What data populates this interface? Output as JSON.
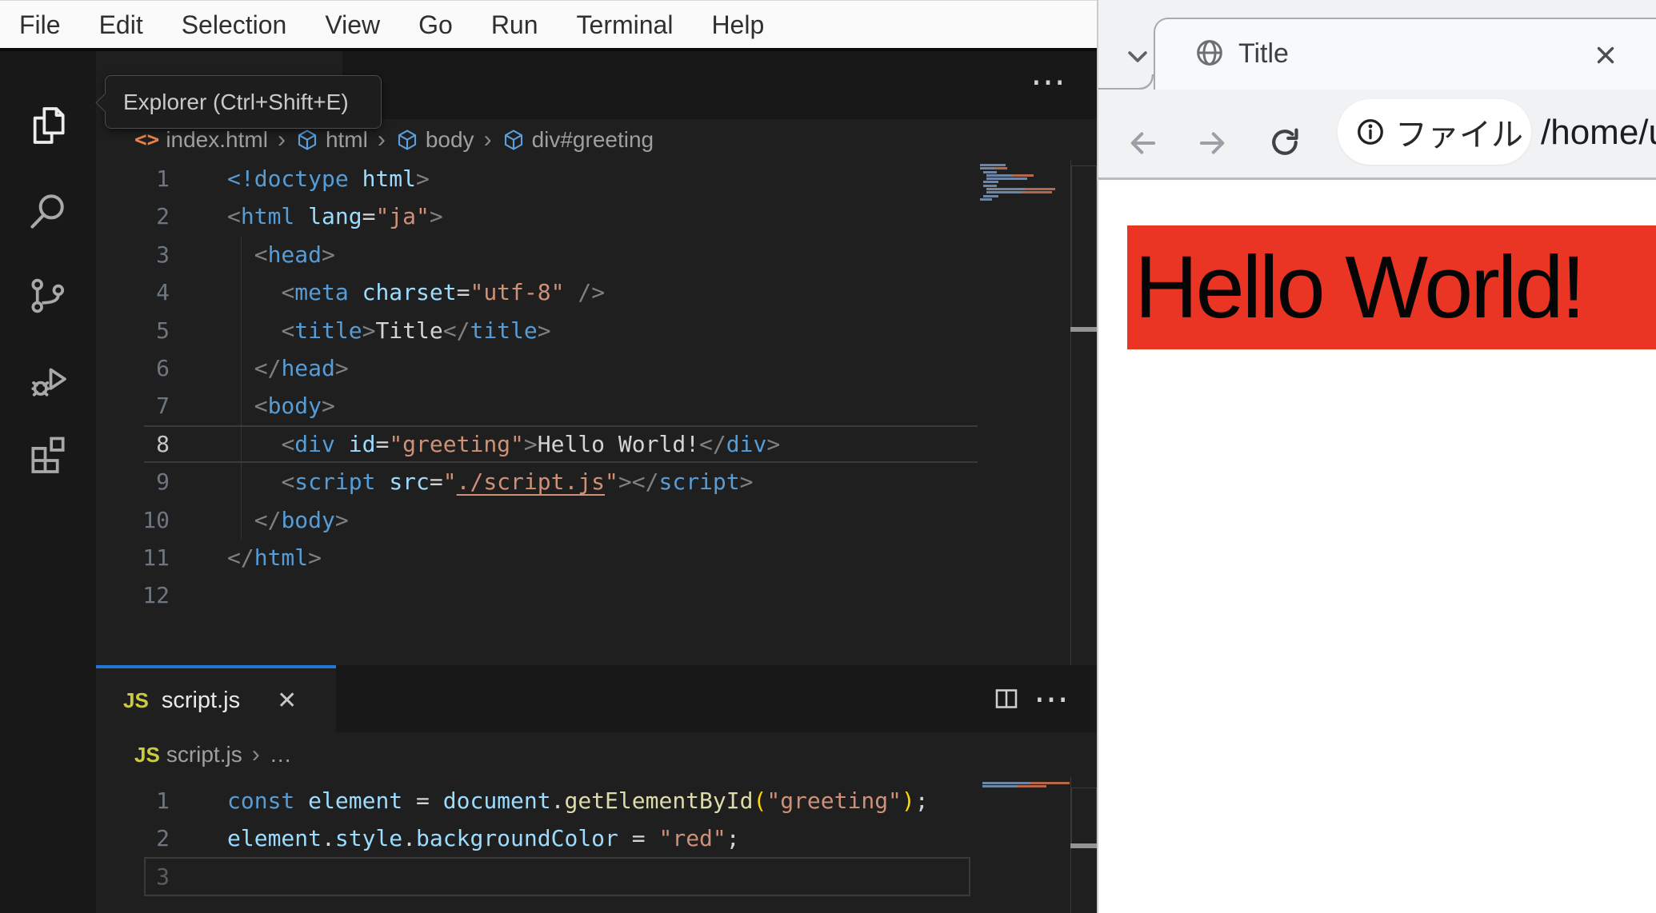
{
  "menubar": {
    "items": [
      "File",
      "Edit",
      "Selection",
      "View",
      "Go",
      "Run",
      "Terminal",
      "Help"
    ]
  },
  "activity_bar": {
    "tooltip": "Explorer (Ctrl+Shift+E)",
    "icons": [
      {
        "name": "explorer",
        "active": true
      },
      {
        "name": "search",
        "active": false
      },
      {
        "name": "source-control",
        "active": false
      },
      {
        "name": "run-and-debug",
        "active": false
      },
      {
        "name": "extensions",
        "active": false
      }
    ]
  },
  "editor_top": {
    "more_actions_glyph": "⋯",
    "breadcrumb": {
      "file_icon_glyph": "<>",
      "file": "index.html",
      "separator": "›",
      "path": [
        "html",
        "body",
        "div#greeting"
      ]
    },
    "active_line": 8,
    "lines": [
      {
        "n": 1,
        "ind": 0,
        "tok": [
          [
            "tg",
            "<!doctype"
          ],
          [
            "pl",
            " "
          ],
          [
            "at",
            "html"
          ],
          [
            "pu",
            ">"
          ]
        ]
      },
      {
        "n": 2,
        "ind": 0,
        "tok": [
          [
            "pu",
            "<"
          ],
          [
            "tg",
            "html"
          ],
          [
            "pl",
            " "
          ],
          [
            "at",
            "lang"
          ],
          [
            "pl",
            "="
          ],
          [
            "st",
            "\"ja\""
          ],
          [
            "pu",
            ">"
          ]
        ]
      },
      {
        "n": 3,
        "ind": 2,
        "tok": [
          [
            "pu",
            "<"
          ],
          [
            "tg",
            "head"
          ],
          [
            "pu",
            ">"
          ]
        ]
      },
      {
        "n": 4,
        "ind": 4,
        "tok": [
          [
            "pu",
            "<"
          ],
          [
            "tg",
            "meta"
          ],
          [
            "pl",
            " "
          ],
          [
            "at",
            "charset"
          ],
          [
            "pl",
            "="
          ],
          [
            "st",
            "\"utf-8\""
          ],
          [
            "pl",
            " "
          ],
          [
            "pu",
            "/>"
          ]
        ]
      },
      {
        "n": 5,
        "ind": 4,
        "tok": [
          [
            "pu",
            "<"
          ],
          [
            "tg",
            "title"
          ],
          [
            "pu",
            ">"
          ],
          [
            "pl",
            "Title"
          ],
          [
            "pu",
            "</"
          ],
          [
            "tg",
            "title"
          ],
          [
            "pu",
            ">"
          ]
        ]
      },
      {
        "n": 6,
        "ind": 2,
        "tok": [
          [
            "pu",
            "</"
          ],
          [
            "tg",
            "head"
          ],
          [
            "pu",
            ">"
          ]
        ]
      },
      {
        "n": 7,
        "ind": 2,
        "tok": [
          [
            "pu",
            "<"
          ],
          [
            "tg",
            "body"
          ],
          [
            "pu",
            ">"
          ]
        ]
      },
      {
        "n": 8,
        "ind": 4,
        "tok": [
          [
            "pu",
            "<"
          ],
          [
            "tg",
            "div"
          ],
          [
            "pl",
            " "
          ],
          [
            "at",
            "id"
          ],
          [
            "pl",
            "="
          ],
          [
            "st",
            "\"greeting\""
          ],
          [
            "pu",
            ">"
          ],
          [
            "pl",
            "Hello World!"
          ],
          [
            "pu",
            "</"
          ],
          [
            "tg",
            "div"
          ],
          [
            "pu",
            ">"
          ]
        ]
      },
      {
        "n": 9,
        "ind": 4,
        "tok": [
          [
            "pu",
            "<"
          ],
          [
            "tg",
            "script"
          ],
          [
            "pl",
            " "
          ],
          [
            "at",
            "src"
          ],
          [
            "pl",
            "="
          ],
          [
            "st",
            "\""
          ],
          [
            "lk",
            "./script.js"
          ],
          [
            "st",
            "\""
          ],
          [
            "pu",
            ">"
          ],
          [
            "pu",
            "</"
          ],
          [
            "tg",
            "script"
          ],
          [
            "pu",
            ">"
          ]
        ]
      },
      {
        "n": 10,
        "ind": 2,
        "tok": [
          [
            "pu",
            "</"
          ],
          [
            "tg",
            "body"
          ],
          [
            "pu",
            ">"
          ]
        ]
      },
      {
        "n": 11,
        "ind": 0,
        "tok": [
          [
            "pu",
            "</"
          ],
          [
            "tg",
            "html"
          ],
          [
            "pu",
            ">"
          ]
        ]
      },
      {
        "n": 12,
        "ind": 0,
        "tok": []
      }
    ]
  },
  "editor_bottom": {
    "tab": {
      "badge": "JS",
      "label": "script.js",
      "close_glyph": "✕"
    },
    "more_actions_glyph": "⋯",
    "breadcrumb": {
      "badge": "JS",
      "file": "script.js",
      "separator": "›",
      "ellipsis": "…"
    },
    "active_line": 3,
    "lines": [
      {
        "n": 1,
        "ind": 0,
        "tok": [
          [
            "kw",
            "const"
          ],
          [
            "pl",
            " "
          ],
          [
            "at",
            "element"
          ],
          [
            "pl",
            " = "
          ],
          [
            "at",
            "document"
          ],
          [
            "pl",
            "."
          ],
          [
            "fn",
            "getElementById"
          ],
          [
            "br",
            "("
          ],
          [
            "st",
            "\"greeting\""
          ],
          [
            "br",
            ")"
          ],
          [
            "pl",
            ";"
          ]
        ]
      },
      {
        "n": 2,
        "ind": 0,
        "tok": [
          [
            "at",
            "element"
          ],
          [
            "pl",
            "."
          ],
          [
            "at",
            "style"
          ],
          [
            "pl",
            "."
          ],
          [
            "at",
            "backgroundColor"
          ],
          [
            "pl",
            " = "
          ],
          [
            "st",
            "\"red\""
          ],
          [
            "pl",
            ";"
          ]
        ]
      },
      {
        "n": 3,
        "ind": 0,
        "tok": []
      }
    ]
  },
  "browser": {
    "tab": {
      "title": "Title"
    },
    "toolbar": {
      "chip_label": "ファイル",
      "url": "/home/u"
    },
    "page": {
      "heading": "Hello World!",
      "heading_bg": "#ea3424",
      "heading_text_color": "#050505"
    }
  },
  "colors": {
    "active_tab_border": "#2277d4",
    "editor_bg": "#1f1f1f",
    "panel_bg": "#181818",
    "menubar_bg": "#fafafa",
    "minimap_code": "#6e86a3",
    "minimap_string": "#b3684a"
  }
}
